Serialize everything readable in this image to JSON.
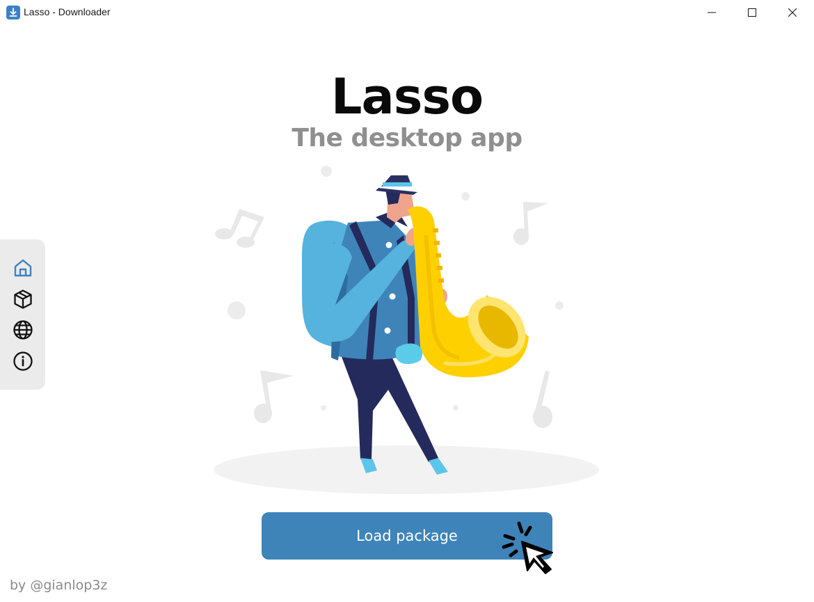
{
  "window": {
    "title": "Lasso - Downloader",
    "icon": "download-icon",
    "controls": [
      "minimize-icon",
      "maximize-icon",
      "close-icon"
    ]
  },
  "hero": {
    "title": "Lasso",
    "subtitle": "The desktop app"
  },
  "sidebar": {
    "items": [
      {
        "icon": "home-icon",
        "active": true
      },
      {
        "icon": "package-icon",
        "active": false
      },
      {
        "icon": "globe-icon",
        "active": false
      },
      {
        "icon": "info-icon",
        "active": false
      }
    ]
  },
  "main": {
    "illustration": "saxophone-player-illustration",
    "load_button_label": "Load package",
    "cursor_icon": "click-cursor-icon"
  },
  "footer": {
    "credit": "by @gianlop3z"
  },
  "colors": {
    "accent": "#3e84b9",
    "active_nav": "#3b82c4",
    "sidebar_bg": "#ebebeb",
    "subtitle": "#8f8f8f"
  }
}
